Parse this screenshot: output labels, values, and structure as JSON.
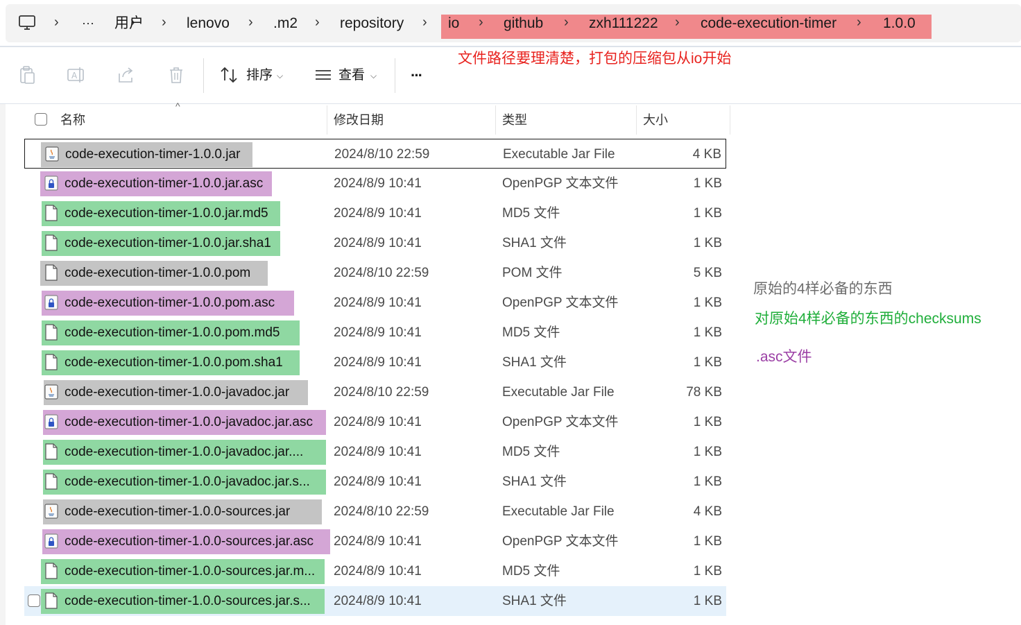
{
  "breadcrumb": {
    "items": [
      "用户",
      "lenovo",
      ".m2",
      "repository",
      "io",
      "github",
      "zxh111222",
      "code-execution-timer",
      "1.0.0"
    ],
    "more": "···"
  },
  "toolbar": {
    "sort_label": "排序",
    "view_label": "查看",
    "more_label": "···"
  },
  "annotations": {
    "path_note": "文件路径要理清楚，打包的压缩包从io开始",
    "original_four": "原始的4样必备的东西",
    "checksums": "对原始4样必备的东西的checksums",
    "asc_files": ".asc文件"
  },
  "columns": {
    "name": "名称",
    "date": "修改日期",
    "type": "类型",
    "size": "大小"
  },
  "colors": {
    "highlight_red": "#f0888b",
    "highlight_gray": "#c4c4c4",
    "highlight_purple": "#d4a6d6",
    "highlight_green": "#8fd8a2",
    "note_red": "#e8221e",
    "note_gray": "#6e6e6e",
    "note_green": "#1fae3a",
    "note_purple": "#9b3fa5"
  },
  "files": [
    {
      "name": "code-execution-timer-1.0.0.jar",
      "date": "2024/8/10 22:59",
      "type": "Executable Jar File",
      "size": "4 KB",
      "icon": "jar-icon",
      "highlight": "gray"
    },
    {
      "name": "code-execution-timer-1.0.0.jar.asc",
      "date": "2024/8/9 10:41",
      "type": "OpenPGP 文本文件",
      "size": "1 KB",
      "icon": "lock-file-icon",
      "highlight": "purple"
    },
    {
      "name": "code-execution-timer-1.0.0.jar.md5",
      "date": "2024/8/9 10:41",
      "type": "MD5 文件",
      "size": "1 KB",
      "icon": "file-icon",
      "highlight": "green"
    },
    {
      "name": "code-execution-timer-1.0.0.jar.sha1",
      "date": "2024/8/9 10:41",
      "type": "SHA1 文件",
      "size": "1 KB",
      "icon": "file-icon",
      "highlight": "green"
    },
    {
      "name": "code-execution-timer-1.0.0.pom",
      "date": "2024/8/10 22:59",
      "type": "POM 文件",
      "size": "5 KB",
      "icon": "file-icon",
      "highlight": "gray"
    },
    {
      "name": "code-execution-timer-1.0.0.pom.asc",
      "date": "2024/8/9 10:41",
      "type": "OpenPGP 文本文件",
      "size": "1 KB",
      "icon": "lock-file-icon",
      "highlight": "purple"
    },
    {
      "name": "code-execution-timer-1.0.0.pom.md5",
      "date": "2024/8/9 10:41",
      "type": "MD5 文件",
      "size": "1 KB",
      "icon": "file-icon",
      "highlight": "green"
    },
    {
      "name": "code-execution-timer-1.0.0.pom.sha1",
      "date": "2024/8/9 10:41",
      "type": "SHA1 文件",
      "size": "1 KB",
      "icon": "file-icon",
      "highlight": "green"
    },
    {
      "name": "code-execution-timer-1.0.0-javadoc.jar",
      "date": "2024/8/10 22:59",
      "type": "Executable Jar File",
      "size": "78 KB",
      "icon": "jar-icon",
      "highlight": "gray"
    },
    {
      "name": "code-execution-timer-1.0.0-javadoc.jar.asc",
      "date": "2024/8/9 10:41",
      "type": "OpenPGP 文本文件",
      "size": "1 KB",
      "icon": "lock-file-icon",
      "highlight": "purple"
    },
    {
      "name": "code-execution-timer-1.0.0-javadoc.jar....",
      "date": "2024/8/9 10:41",
      "type": "MD5 文件",
      "size": "1 KB",
      "icon": "file-icon",
      "highlight": "green"
    },
    {
      "name": "code-execution-timer-1.0.0-javadoc.jar.s...",
      "date": "2024/8/9 10:41",
      "type": "SHA1 文件",
      "size": "1 KB",
      "icon": "file-icon",
      "highlight": "green"
    },
    {
      "name": "code-execution-timer-1.0.0-sources.jar",
      "date": "2024/8/10 22:59",
      "type": "Executable Jar File",
      "size": "4 KB",
      "icon": "jar-icon",
      "highlight": "gray"
    },
    {
      "name": "code-execution-timer-1.0.0-sources.jar.asc",
      "date": "2024/8/9 10:41",
      "type": "OpenPGP 文本文件",
      "size": "1 KB",
      "icon": "lock-file-icon",
      "highlight": "purple"
    },
    {
      "name": "code-execution-timer-1.0.0-sources.jar.m...",
      "date": "2024/8/9 10:41",
      "type": "MD5 文件",
      "size": "1 KB",
      "icon": "file-icon",
      "highlight": "green"
    },
    {
      "name": "code-execution-timer-1.0.0-sources.jar.s...",
      "date": "2024/8/9 10:41",
      "type": "SHA1 文件",
      "size": "1 KB",
      "icon": "file-icon",
      "highlight": "green"
    }
  ]
}
